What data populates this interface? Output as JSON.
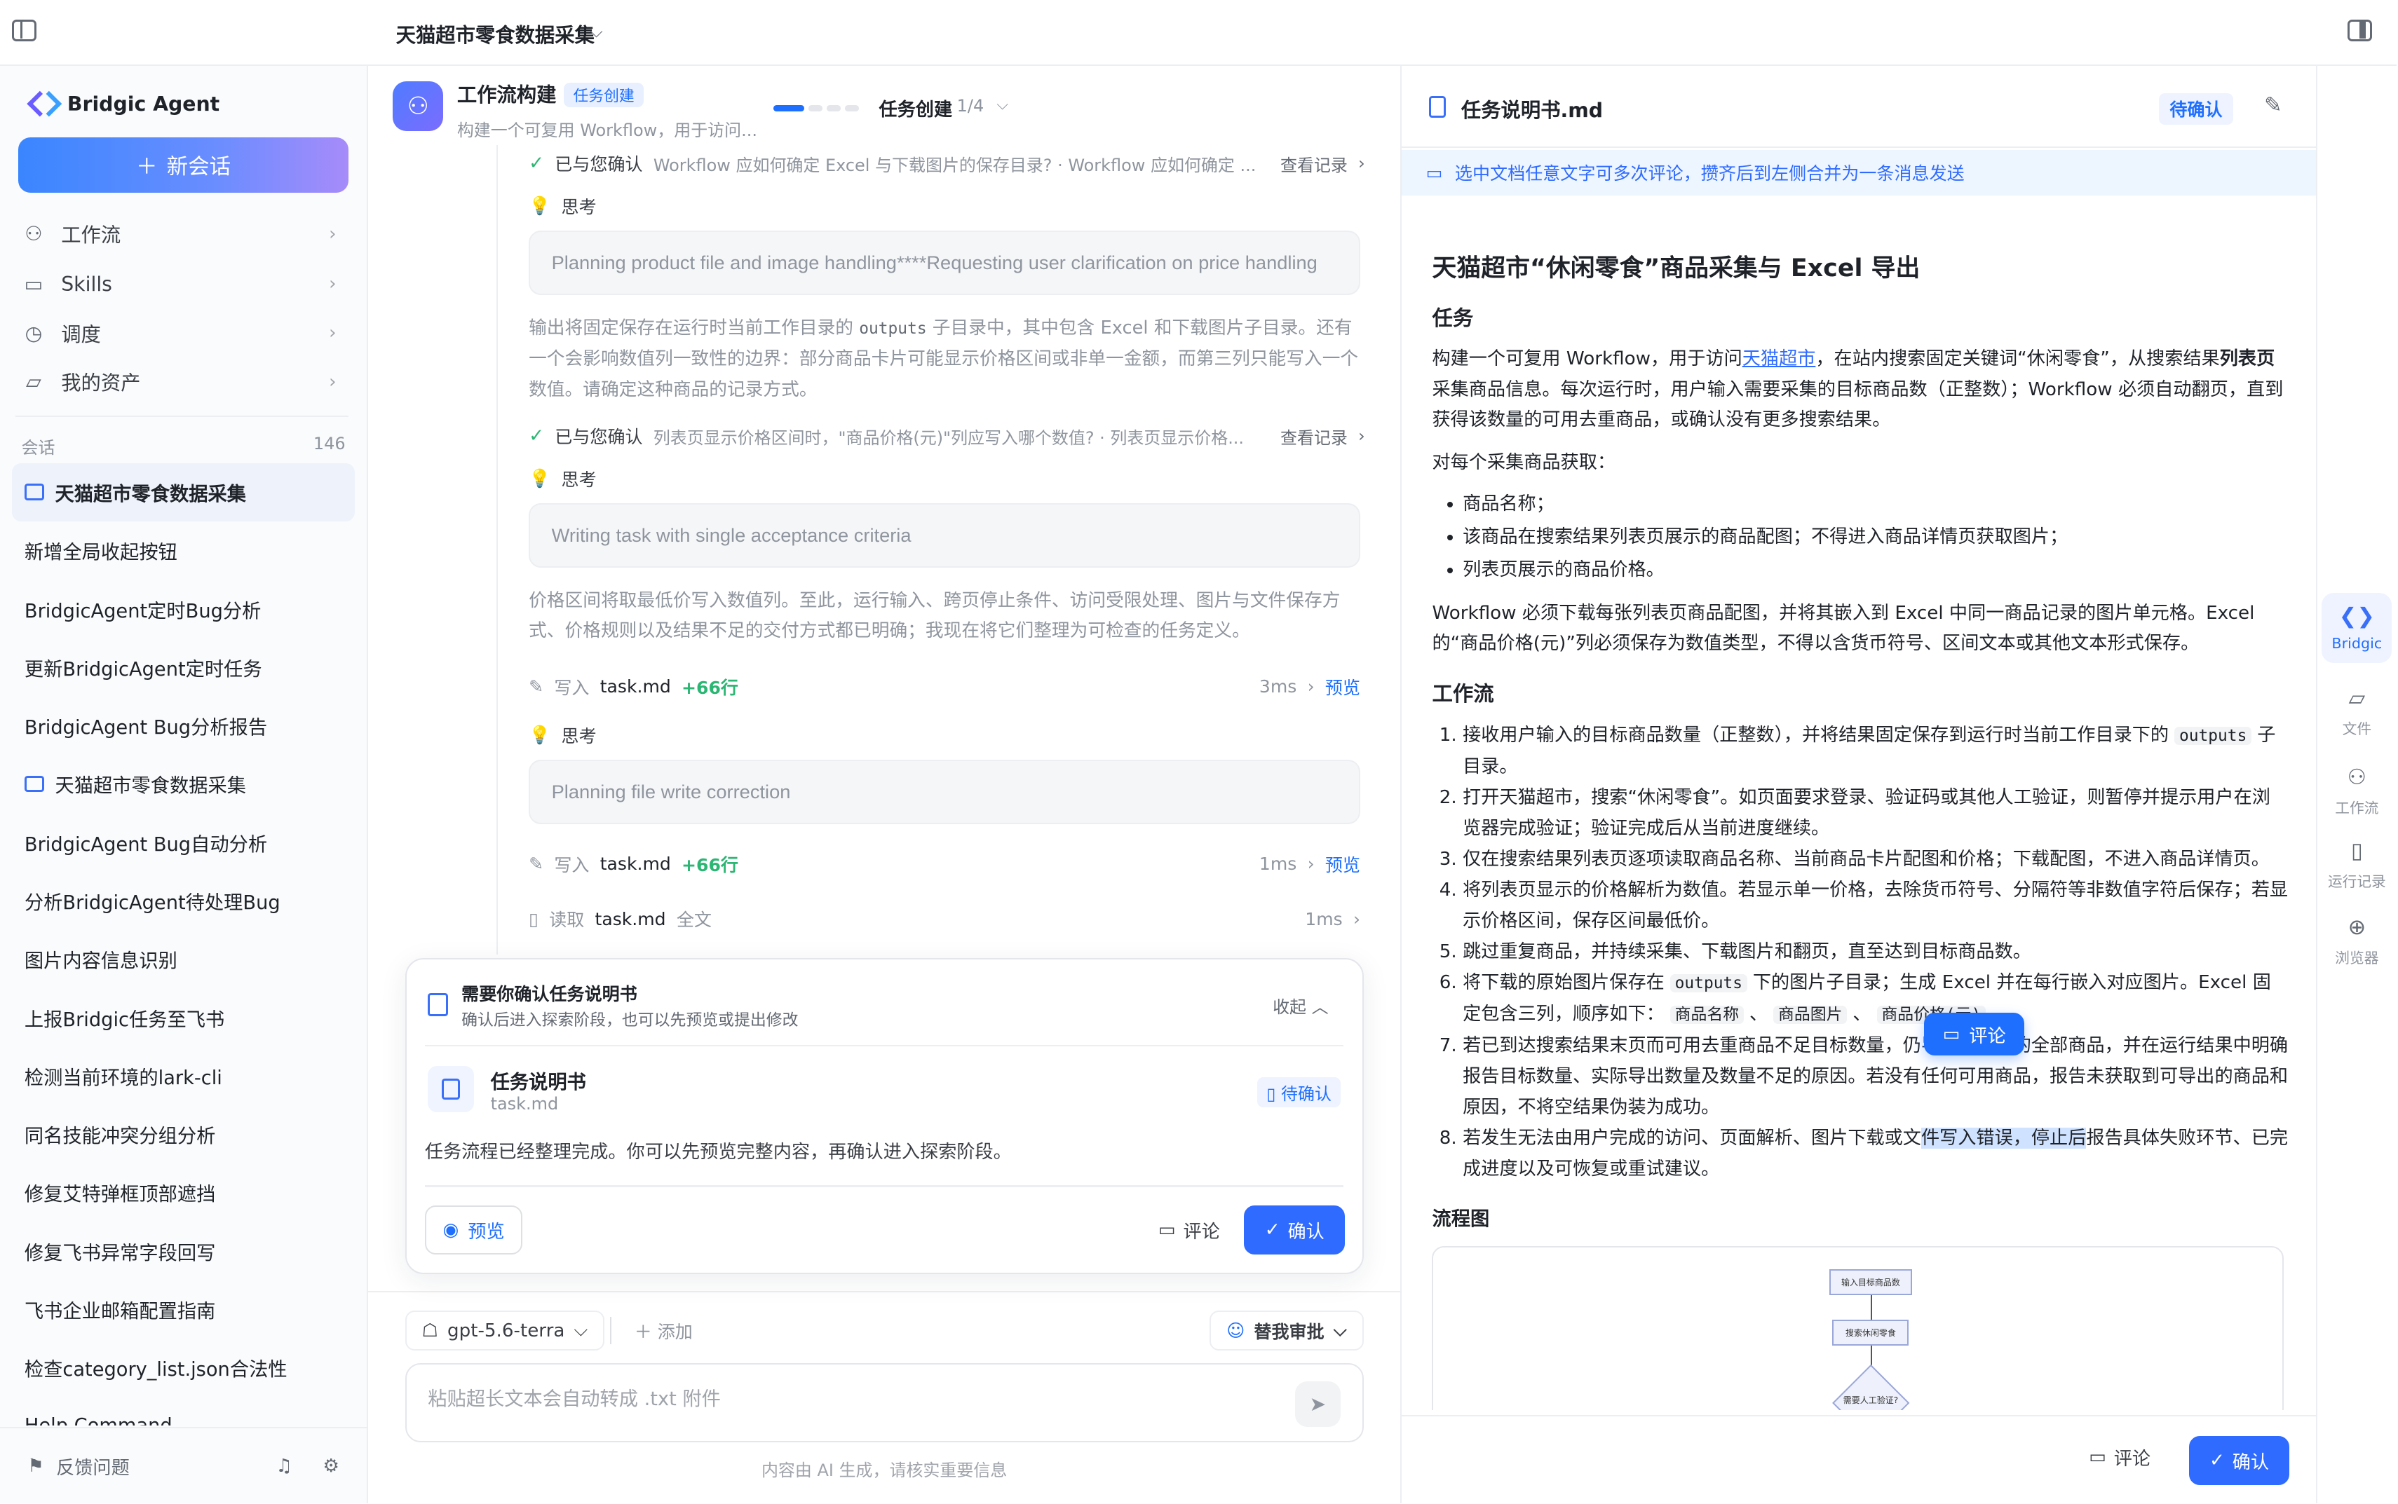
{
  "topbar": {
    "title": "天猫超市零食数据采集"
  },
  "sidebar": {
    "brand": "Bridgic Agent",
    "new_chat": "新会话",
    "nav": [
      {
        "label": "工作流",
        "icon": "workflow-icon"
      },
      {
        "label": "Skills",
        "icon": "terminal-icon"
      },
      {
        "label": "调度",
        "icon": "clock-icon"
      },
      {
        "label": "我的资产",
        "icon": "folder-icon"
      }
    ],
    "conversations_label": "会话",
    "conversations_count": "146",
    "conversations": [
      "天猫超市零食数据采集",
      "新增全局收起按钮",
      "BridgicAgent定时Bug分析",
      "更新BridgicAgent定时任务",
      "BridgicAgent Bug分析报告",
      "天猫超市零食数据采集",
      "BridgicAgent Bug自动分析",
      "分析BridgicAgent待处理Bug",
      "图片内容信息识别",
      "上报Bridgic任务至飞书",
      "检测当前环境的lark-cli",
      "同名技能冲突分组分析",
      "修复艾特弹框顶部遮挡",
      "修复飞书异常字段回写",
      "飞书企业邮箱配置指南",
      "检查category_list.json合法性",
      "Help Command"
    ],
    "feedback": "反馈问题"
  },
  "mid": {
    "title": "工作流构建",
    "badge": "任务创建",
    "subtitle": "构建一个可复用 Workflow，用于访问...",
    "step_label": "任务创建",
    "step_count": "1/4",
    "confirm1": {
      "label": "已与您确认",
      "text": "Workflow 应如何确定 Excel 与下载图片的保存目录? · Workflow 应如何确定 ...",
      "record": "查看记录"
    },
    "think_label": "思考",
    "think1": "Planning product file and image handling****Requesting user clarification on price handling",
    "para1_a": "输出将固定保存在运行时当前工作目录的",
    "para1_code": "outputs",
    "para1_b": "子目录中，其中包含 Excel 和下载图片子目录。还有一个会影响数值列一致性的边界：部分商品卡片可能显示价格区间或非单一金额，而第三列只能写入一个数值。请确定这种商品的记录方式。",
    "confirm2": {
      "label": "已与您确认",
      "text": "列表页显示价格区间时，\"商品价格(元)\"列应写入哪个数值? · 列表页显示价格...",
      "record": "查看记录"
    },
    "think2": "Writing task with single acceptance criteria",
    "para2": "价格区间将取最低价写入数值列。至此，运行输入、跨页停止条件、访问受限处理、图片与文件保存方式、价格规则以及结果不足的交付方式都已明确；我现在将它们整理为可检查的任务定义。",
    "write1": {
      "action": "写入",
      "file": "task.md",
      "delta": "+66行",
      "time": "3ms",
      "preview": "预览"
    },
    "think3": "Planning file write correction",
    "write2": {
      "action": "写入",
      "file": "task.md",
      "delta": "+66行",
      "time": "1ms",
      "preview": "预览"
    },
    "read1": {
      "action": "读取",
      "file": "task.md",
      "extra": "全文",
      "time": "1ms"
    },
    "card": {
      "title": "需要你确认任务说明书",
      "subtitle": "确认后进入探索阶段，也可以先预览或提出修改",
      "collapse": "收起",
      "file_name": "任务说明书",
      "file_sub": "task.md",
      "status": "待确认",
      "message": "任务流程已经整理完成。你可以先预览完整内容，再确认进入探索阶段。",
      "preview": "预览",
      "comment": "评论",
      "confirm": "确认"
    },
    "model": "gpt-5.6-terra",
    "add": "添加",
    "approve": "替我审批",
    "input_placeholder": "粘贴超长文本会自动转成 .txt 附件",
    "disclaimer": "内容由 AI 生成，请核实重要信息"
  },
  "doc": {
    "file_name": "任务说明书.md",
    "status": "待确认",
    "tip": "选中文档任意文字可多次评论，攒齐后到左侧合并为一条消息发送",
    "h1": "天猫超市“休闲零食”商品采集与 Excel 导出",
    "sec_task": "任务",
    "task_p1_a": "构建一个可复用 Workflow，用于访问",
    "task_link": "天猫超市",
    "task_p1_b": "，在站内搜索固定关键词“休闲零食”，从搜索结果",
    "task_p1_bold": "列表页",
    "task_p1_c": "采集商品信息。每次运行时，用户输入需要采集的目标商品数（正整数）；Workflow 必须自动翻页，直到获得该数量的可用去重商品，或确认没有更多搜索结果。",
    "task_p2": "对每个采集商品获取：",
    "bullets": [
      "商品名称；",
      "该商品在搜索结果列表页展示的商品配图；不得进入商品详情页获取图片；",
      "列表页展示的商品价格。"
    ],
    "task_p3": "Workflow 必须下载每张列表页商品配图，并将其嵌入到 Excel 中同一商品记录的图片单元格。Excel 的“商品价格(元)”列必须保存为数值类型，不得以含货币符号、区间文本或其他文本形式保存。",
    "sec_flow": "工作流",
    "steps": {
      "s1a": "接收用户输入的目标商品数量（正整数），并将结果固定保存到运行时当前工作目录下的",
      "s1code": "outputs",
      "s1b": "子目录。",
      "s2": "打开天猫超市，搜索“休闲零食”。如页面要求登录、验证码或其他人工验证，则暂停并提示用户在浏览器完成验证；验证完成后从当前进度继续。",
      "s3": "仅在搜索结果列表页逐项读取商品名称、当前商品卡片配图和价格；下载配图，不进入商品详情页。",
      "s4": "将列表页显示的价格解析为数值。若显示单一价格，去除货币符号、分隔符等非数值字符后保存；若显示价格区间，保存区间最低价。",
      "s5": "跳过重复商品，并持续采集、下载图片和翻页，直至达到目标商品数。",
      "s6a": "将下载的原始图片保存在",
      "s6code": "outputs",
      "s6b": "下的图片子目录；生成 Excel 并在每行嵌入对应图片。Excel 固定包含三列，顺序如下：",
      "s6c1": "商品名称",
      "s6c2": "商品图片",
      "s6c3": "商品价格(元)",
      "s7": "若已到达搜索结果末页而可用去重商品不足目标数量，仍导出已获取的全部商品，并在运行结果中明确报告目标数量、实际导出数量及数量不足的原因。若没有任何可用商品，报告未获取到可导出的商品和原因，不将空结果伪装为成功。",
      "s8a": "若发生无法由用户完成的访问、页面解析、图片下载或文",
      "s8hl": "件写入错误，停止后",
      "s8b": "报告具体失败环节、已完成进度以及可恢复或重试建议。"
    },
    "comment_pop": "评论",
    "sec_chart": "流程图",
    "flow_nodes": [
      "输入目标商品数",
      "搜索休闲零食",
      "需要人工验证?"
    ],
    "footer_comment": "评论",
    "footer_confirm": "确认"
  },
  "rail": [
    {
      "label": "Bridgic",
      "icon": "bridgic-icon"
    },
    {
      "label": "文件",
      "icon": "folder-icon"
    },
    {
      "label": "工作流",
      "icon": "workflow-icon"
    },
    {
      "label": "运行记录",
      "icon": "record-icon"
    },
    {
      "label": "浏览器",
      "icon": "globe-icon"
    }
  ]
}
